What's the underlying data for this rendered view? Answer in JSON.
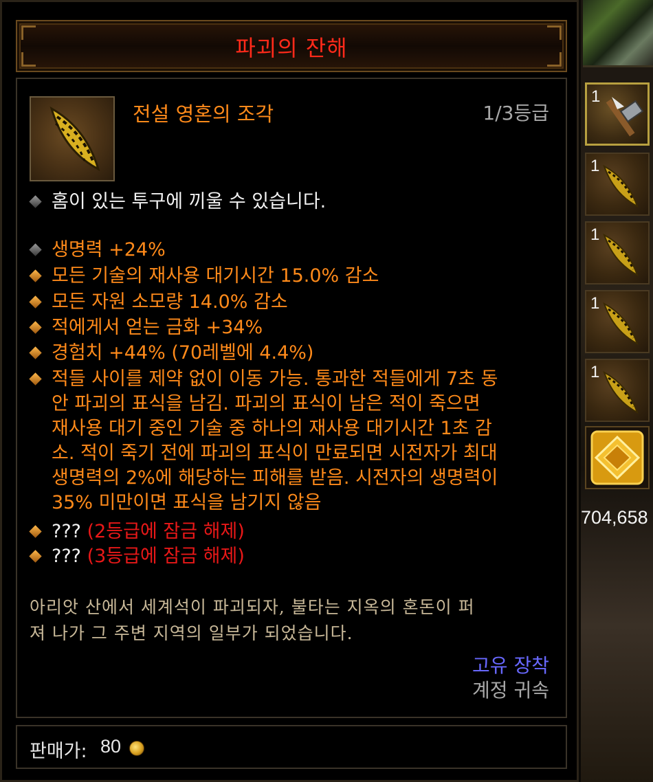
{
  "item": {
    "name": "파괴의 잔해",
    "type": "전설 영혼의 조각",
    "grade": "1/3등급",
    "socket_text": "홈이 있는 투구에 끼울 수 있습니다.",
    "stats": [
      {
        "text": "생명력 +24%",
        "bullet": "gray"
      },
      {
        "text": "모든 기술의 재사용 대기시간 15.0% 감소",
        "bullet": "gold"
      },
      {
        "text": "모든 자원 소모량 14.0% 감소",
        "bullet": "gold"
      },
      {
        "text": "적에게서 얻는 금화 +34%",
        "bullet": "gold"
      },
      {
        "text": "경험치 +44% (70레벨에 4.4%)",
        "bullet": "gold"
      }
    ],
    "passive": {
      "lines": [
        "적들 사이를 제약 없이 이동 가능. 통과한 적들에게 7초 동",
        "안 파괴의 표식을 남김. 파괴의 표식이 남은 적이 죽으면",
        "재사용 대기 중인 기술 중 하나의 재사용 대기시간 1초 감",
        "소. 적이 죽기 전에 파괴의 표식이 만료되면 시전자가 최대",
        "생명력의 2%에 해당하는 피해를 받음. 시전자의 생명력이",
        "35% 미만이면 표식을 남기지 않음"
      ]
    },
    "locked": [
      {
        "prefix": "???",
        "text": "(2등급에 잠금 해제)"
      },
      {
        "prefix": "???",
        "text": "(3등급에 잠금 해제)"
      }
    ],
    "flavor": [
      "아리앗 산에서 세계석이 파괴되자, 불타는 지옥의 혼돈이 퍼",
      "져 나가 그 주변 지역의 일부가 되었습니다."
    ],
    "account_flag": "고유 장착",
    "account_bound": "계정 귀속",
    "sell_label": "판매가:",
    "sell_value": "80"
  },
  "inventory": {
    "slots": [
      {
        "count": "1",
        "icon": "hammer-icon"
      },
      {
        "count": "1",
        "icon": "soul-shard-icon"
      },
      {
        "count": "1",
        "icon": "soul-shard-icon"
      },
      {
        "count": "1",
        "icon": "soul-shard-icon"
      },
      {
        "count": "1",
        "icon": "soul-shard-icon"
      }
    ],
    "gem_icon": "gem-icon",
    "gold": "704,658"
  },
  "colors": {
    "title": "#ff2a1a",
    "legendary_orange": "#ff8a1a",
    "locked_red": "#e81818",
    "account_flag_blue": "#6868ff",
    "gray_text": "#a8a8a8",
    "flavor": "#c8b898"
  }
}
